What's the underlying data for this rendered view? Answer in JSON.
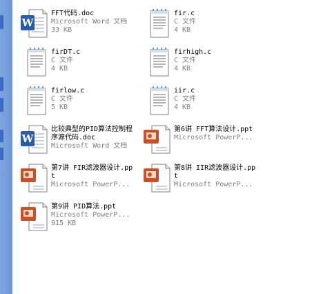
{
  "files": [
    {
      "name": "FFT代码.doc",
      "type": "Microsoft Word 文档",
      "size": "33 KB",
      "icon": "word-doc-icon"
    },
    {
      "name": "fir.c",
      "type": "C 文件",
      "size": "4 KB",
      "icon": "c-file-icon"
    },
    {
      "name": "firDT.c",
      "type": "C 文件",
      "size": "4 KB",
      "icon": "c-file-icon"
    },
    {
      "name": "firhigh.c",
      "type": "C 文件",
      "size": "4 KB",
      "icon": "c-file-icon"
    },
    {
      "name": "firlow.c",
      "type": "C 文件",
      "size": "5 KB",
      "icon": "c-file-icon"
    },
    {
      "name": "iir.c",
      "type": "C 文件",
      "size": "4 KB",
      "icon": "c-file-icon"
    },
    {
      "name": "比较典型的PID算法控制程序源代码.doc",
      "type": "Microsoft Word 文档",
      "size": "",
      "icon": "word-doc-icon"
    },
    {
      "name": "第6讲 FFT算法设计.ppt",
      "type": "Microsoft PowerP...",
      "size": "",
      "icon": "powerpoint-icon"
    },
    {
      "name": "第7讲 FIR滤波器设计.ppt",
      "type": "Microsoft PowerP...",
      "size": "",
      "icon": "powerpoint-icon"
    },
    {
      "name": "第8讲 IIR滤波器设计.ppt",
      "type": "Microsoft PowerP...",
      "size": "",
      "icon": "powerpoint-icon"
    },
    {
      "name": "第9讲 PID算法.ppt",
      "type": "Microsoft PowerP...",
      "size": "915 KB",
      "icon": "powerpoint-icon"
    }
  ]
}
